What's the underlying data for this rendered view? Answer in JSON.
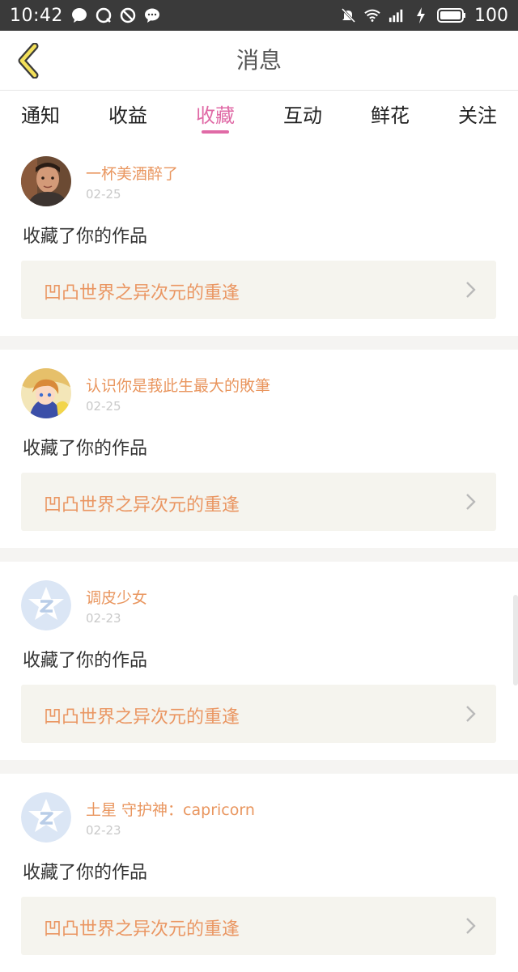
{
  "status_bar": {
    "time": "10:42",
    "battery": "100"
  },
  "header": {
    "title": "消息"
  },
  "tabs": [
    {
      "label": "通知"
    },
    {
      "label": "收益"
    },
    {
      "label": "收藏"
    },
    {
      "label": "互动"
    },
    {
      "label": "鲜花"
    },
    {
      "label": "关注"
    }
  ],
  "active_tab_index": 2,
  "colors": {
    "accent": "#e06aa6",
    "name": "#e9965f",
    "work": "#ea9662",
    "work_bg": "#f5f4ee"
  },
  "items": [
    {
      "user": "一杯美酒醉了",
      "date": "02-25",
      "action": "收藏了你的作品",
      "work_title": "凹凸世界之异次元的重逢",
      "avatar": "photo-avatar"
    },
    {
      "user": "认识你是莪此生最大的敗筆",
      "date": "02-25",
      "action": "收藏了你的作品",
      "work_title": "凹凸世界之异次元的重逢",
      "avatar": "anime-avatar"
    },
    {
      "user": "调皮少女",
      "date": "02-23",
      "action": "收藏了你的作品",
      "work_title": "凹凸世界之异次元的重逢",
      "avatar": "default-avatar"
    },
    {
      "user": "土星 守护神：capricorn",
      "date": "02-23",
      "action": "收藏了你的作品",
      "work_title": "凹凸世界之异次元的重逢",
      "avatar": "default-avatar"
    }
  ]
}
